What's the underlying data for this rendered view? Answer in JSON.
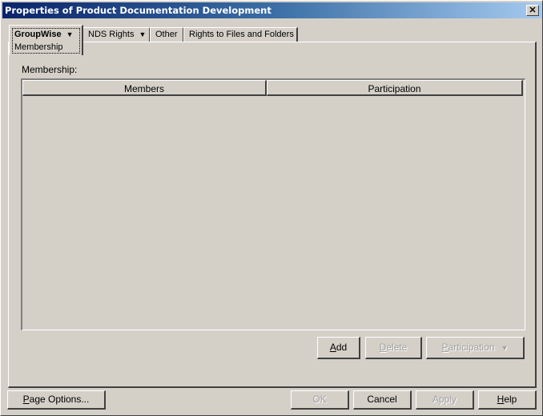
{
  "window": {
    "title": "Properties of Product Documentation Development",
    "close_label": "✕"
  },
  "tabs": [
    {
      "label": "GroupWise",
      "has_dropdown": true,
      "active": true,
      "sub_label": "Membership"
    },
    {
      "label": "NDS Rights",
      "has_dropdown": true,
      "active": false
    },
    {
      "label": "Other",
      "has_dropdown": false,
      "active": false
    },
    {
      "label": "Rights to Files and Folders",
      "has_dropdown": false,
      "active": false
    }
  ],
  "icons": {
    "dropdown_arrow": "▼"
  },
  "membership": {
    "label": "Membership:",
    "columns": [
      "Members",
      "Participation"
    ],
    "rows": []
  },
  "panel_buttons": {
    "add": {
      "mnemonic": "A",
      "rest": "dd",
      "enabled": true
    },
    "delete": {
      "mnemonic": "D",
      "rest": "elete",
      "enabled": false
    },
    "participation": {
      "mnemonic": "P",
      "rest": "articipation",
      "enabled": false
    }
  },
  "footer_buttons": {
    "page_options": {
      "mnemonic": "P",
      "rest": "age Options...",
      "enabled": true
    },
    "ok": {
      "label": "OK",
      "enabled": false
    },
    "cancel": {
      "label": "Cancel",
      "enabled": true
    },
    "apply": {
      "label": "Apply",
      "enabled": false
    },
    "help": {
      "mnemonic": "H",
      "rest": "elp",
      "enabled": true
    }
  }
}
